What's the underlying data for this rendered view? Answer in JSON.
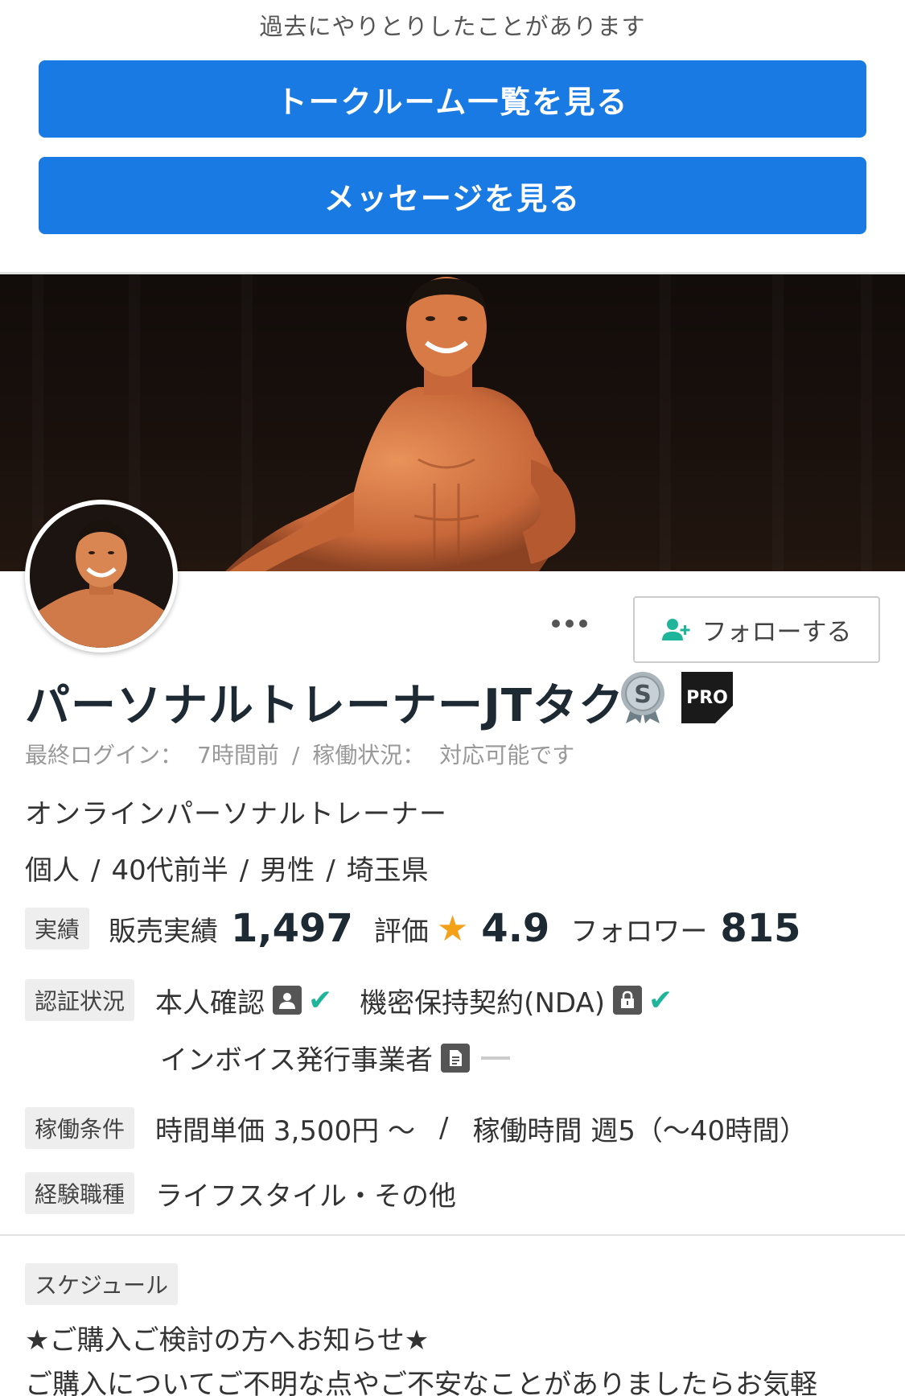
{
  "top": {
    "notice": "過去にやりとりしたことがあります",
    "talkroom_button": "トークルーム一覧を見る",
    "message_button": "メッセージを見る"
  },
  "profile": {
    "more_label": "…",
    "follow_button": "フォローする",
    "name": "パーソナルトレーナーJTタク",
    "rank_badge": "S",
    "pro_badge": "PRO",
    "login_label": "最終ログイン：",
    "login_value": "7時間前",
    "status_label": "稼働状況：",
    "status_value": "対応可能です",
    "catchphrase": "オンラインパーソナルトレーナー",
    "attrs": {
      "type": "個人",
      "age": "40代前半",
      "gender": "男性",
      "location": "埼玉県"
    }
  },
  "stats": {
    "tag": "実績",
    "sales_label": "販売実績",
    "sales_value": "1,497",
    "rating_label": "評価",
    "rating_value": "4.9",
    "followers_label": "フォロワー",
    "followers_value": "815"
  },
  "verification": {
    "tag": "認証状況",
    "identity": "本人確認",
    "nda": "機密保持契約(NDA)",
    "invoice": "インボイス発行事業者"
  },
  "conditions": {
    "tag": "稼働条件",
    "rate": "時間単価 3,500円 〜",
    "hours": "稼働時間 週5（〜40時間）"
  },
  "experience": {
    "tag": "経験職種",
    "value": "ライフスタイル・その他"
  },
  "schedule": {
    "tag": "スケジュール",
    "line1": "★ご購入ご検討の方へお知らせ★",
    "line2": "ご購入についてご不明な点やご不安なことがありましたらお気軽"
  },
  "colors": {
    "primary_button": "#1a7ae3",
    "check": "#1fb59a",
    "star": "#f4a11a",
    "name": "#1e2a33"
  },
  "icons": [
    "person-plus-icon",
    "rank-s-icon",
    "pro-icon",
    "star-icon",
    "person-card-icon",
    "check-icon",
    "lock-icon",
    "document-icon",
    "dash-icon"
  ]
}
